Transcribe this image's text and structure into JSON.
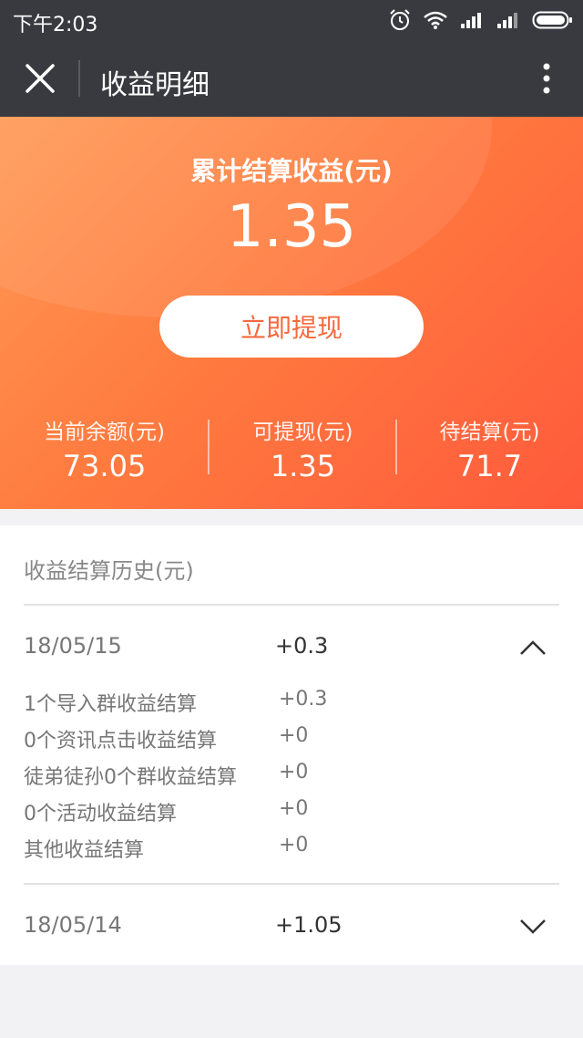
{
  "statusbar": {
    "time": "下午2:03"
  },
  "titlebar": {
    "title": "收益明细"
  },
  "hero": {
    "total_label": "累计结算收益(元)",
    "total_value": "1.35",
    "withdraw_label": "立即提现",
    "stats": [
      {
        "label": "当前余额(元)",
        "value": "73.05"
      },
      {
        "label": "可提现(元)",
        "value": "1.35"
      },
      {
        "label": "待结算(元)",
        "value": "71.7"
      }
    ]
  },
  "history": {
    "header": "收益结算历史(元)",
    "rows": [
      {
        "date": "18/05/15",
        "amount": "+0.3",
        "expanded": true,
        "details": [
          {
            "name": "1个导入群收益结算",
            "amount": "+0.3"
          },
          {
            "name": "0个资讯点击收益结算",
            "amount": "+0"
          },
          {
            "name": "徒弟徒孙0个群收益结算",
            "amount": "+0"
          },
          {
            "name": "0个活动收益结算",
            "amount": "+0"
          },
          {
            "name": "其他收益结算",
            "amount": "+0"
          }
        ]
      },
      {
        "date": "18/05/14",
        "amount": "+1.05",
        "expanded": false
      }
    ]
  },
  "colors": {
    "titlebar": "#393a3f",
    "hero_start": "#ff9a56",
    "hero_end": "#ff5a3c",
    "button_text": "#f36a3e",
    "background": "#f2f2f4"
  },
  "icons": {
    "close": "close-icon",
    "more": "more-vertical-icon",
    "alarm": "alarm-icon",
    "wifi": "wifi-icon",
    "signal": "signal-icon",
    "battery": "battery-icon",
    "collapse": "chevron-up-icon",
    "expand": "chevron-down-icon"
  }
}
